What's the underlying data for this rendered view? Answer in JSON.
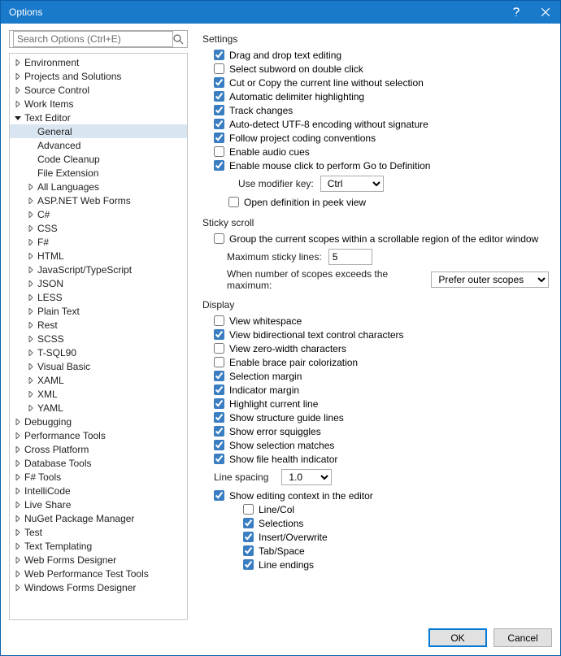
{
  "window": {
    "title": "Options"
  },
  "search": {
    "placeholder": "Search Options (Ctrl+E)"
  },
  "tree": [
    {
      "label": "Environment",
      "depth": 0,
      "expander": "right"
    },
    {
      "label": "Projects and Solutions",
      "depth": 0,
      "expander": "right"
    },
    {
      "label": "Source Control",
      "depth": 0,
      "expander": "right"
    },
    {
      "label": "Work Items",
      "depth": 0,
      "expander": "right"
    },
    {
      "label": "Text Editor",
      "depth": 0,
      "expander": "down"
    },
    {
      "label": "General",
      "depth": 1,
      "expander": "none",
      "selected": true
    },
    {
      "label": "Advanced",
      "depth": 1,
      "expander": "none"
    },
    {
      "label": "Code Cleanup",
      "depth": 1,
      "expander": "none"
    },
    {
      "label": "File Extension",
      "depth": 1,
      "expander": "none"
    },
    {
      "label": "All Languages",
      "depth": 1,
      "expander": "right"
    },
    {
      "label": "ASP.NET Web Forms",
      "depth": 1,
      "expander": "right"
    },
    {
      "label": "C#",
      "depth": 1,
      "expander": "right"
    },
    {
      "label": "CSS",
      "depth": 1,
      "expander": "right"
    },
    {
      "label": "F#",
      "depth": 1,
      "expander": "right"
    },
    {
      "label": "HTML",
      "depth": 1,
      "expander": "right"
    },
    {
      "label": "JavaScript/TypeScript",
      "depth": 1,
      "expander": "right"
    },
    {
      "label": "JSON",
      "depth": 1,
      "expander": "right"
    },
    {
      "label": "LESS",
      "depth": 1,
      "expander": "right"
    },
    {
      "label": "Plain Text",
      "depth": 1,
      "expander": "right"
    },
    {
      "label": "Rest",
      "depth": 1,
      "expander": "right"
    },
    {
      "label": "SCSS",
      "depth": 1,
      "expander": "right"
    },
    {
      "label": "T-SQL90",
      "depth": 1,
      "expander": "right"
    },
    {
      "label": "Visual Basic",
      "depth": 1,
      "expander": "right"
    },
    {
      "label": "XAML",
      "depth": 1,
      "expander": "right"
    },
    {
      "label": "XML",
      "depth": 1,
      "expander": "right"
    },
    {
      "label": "YAML",
      "depth": 1,
      "expander": "right"
    },
    {
      "label": "Debugging",
      "depth": 0,
      "expander": "right"
    },
    {
      "label": "Performance Tools",
      "depth": 0,
      "expander": "right"
    },
    {
      "label": "Cross Platform",
      "depth": 0,
      "expander": "right"
    },
    {
      "label": "Database Tools",
      "depth": 0,
      "expander": "right"
    },
    {
      "label": "F# Tools",
      "depth": 0,
      "expander": "right"
    },
    {
      "label": "IntelliCode",
      "depth": 0,
      "expander": "right"
    },
    {
      "label": "Live Share",
      "depth": 0,
      "expander": "right"
    },
    {
      "label": "NuGet Package Manager",
      "depth": 0,
      "expander": "right"
    },
    {
      "label": "Test",
      "depth": 0,
      "expander": "right"
    },
    {
      "label": "Text Templating",
      "depth": 0,
      "expander": "right"
    },
    {
      "label": "Web Forms Designer",
      "depth": 0,
      "expander": "right"
    },
    {
      "label": "Web Performance Test Tools",
      "depth": 0,
      "expander": "right"
    },
    {
      "label": "Windows Forms Designer",
      "depth": 0,
      "expander": "right"
    }
  ],
  "settings": {
    "title": "Settings",
    "items": [
      {
        "label": "Drag and drop text editing",
        "checked": true
      },
      {
        "label": "Select subword on double click",
        "checked": false
      },
      {
        "label": "Cut or Copy the current line without selection",
        "checked": true
      },
      {
        "label": "Automatic delimiter highlighting",
        "checked": true
      },
      {
        "label": "Track changes",
        "checked": true
      },
      {
        "label": "Auto-detect UTF-8 encoding without signature",
        "checked": true
      },
      {
        "label": "Follow project coding conventions",
        "checked": true
      },
      {
        "label": "Enable audio cues",
        "checked": false
      },
      {
        "label": "Enable mouse click to perform Go to Definition",
        "checked": true
      }
    ],
    "modifier": {
      "label": "Use modifier key:",
      "value": "Ctrl"
    },
    "peek": {
      "label": "Open definition in peek view",
      "checked": false
    }
  },
  "sticky": {
    "title": "Sticky scroll",
    "group": {
      "label": "Group the current scopes within a scrollable region of the editor window",
      "checked": false
    },
    "maxLabel": "Maximum sticky lines:",
    "maxValue": "5",
    "exceedsLabel": "When number of scopes exceeds the maximum:",
    "exceedsValue": "Prefer outer scopes"
  },
  "display": {
    "title": "Display",
    "items": [
      {
        "label": "View whitespace",
        "checked": false
      },
      {
        "label": "View bidirectional text control characters",
        "checked": true
      },
      {
        "label": "View zero-width characters",
        "checked": false
      },
      {
        "label": "Enable brace pair colorization",
        "checked": false
      },
      {
        "label": "Selection margin",
        "checked": true
      },
      {
        "label": "Indicator margin",
        "checked": true
      },
      {
        "label": "Highlight current line",
        "checked": true
      },
      {
        "label": "Show structure guide lines",
        "checked": true
      },
      {
        "label": "Show error squiggles",
        "checked": true
      },
      {
        "label": "Show selection matches",
        "checked": true
      },
      {
        "label": "Show file health indicator",
        "checked": true
      }
    ],
    "lineSpacing": {
      "label": "Line spacing",
      "value": "1.0"
    },
    "context": {
      "label": "Show editing context in the editor",
      "checked": true
    },
    "sub": [
      {
        "label": "Line/Col",
        "checked": false
      },
      {
        "label": "Selections",
        "checked": true
      },
      {
        "label": "Insert/Overwrite",
        "checked": true
      },
      {
        "label": "Tab/Space",
        "checked": true
      },
      {
        "label": "Line endings",
        "checked": true
      }
    ]
  },
  "buttons": {
    "ok": "OK",
    "cancel": "Cancel"
  }
}
